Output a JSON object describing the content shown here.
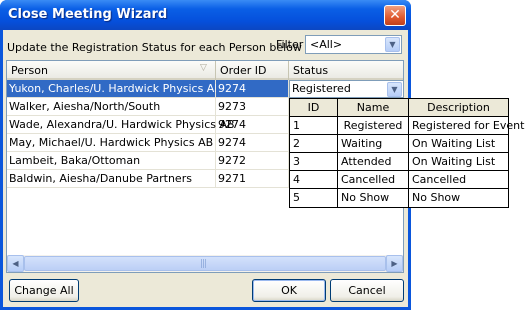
{
  "window": {
    "title": "Close Meeting Wizard",
    "close_glyph": "✕"
  },
  "instruction": "Update the Registration Status for each Person below",
  "filter": {
    "label": "Filter",
    "value": "<All>"
  },
  "grid": {
    "columns": [
      "Person",
      "Order ID",
      "Status"
    ],
    "rows": [
      {
        "person": "Yukon, Charles/U. Hardwick Physics AB",
        "order_id": "9274",
        "status": ""
      },
      {
        "person": "Walker, Aiesha/North/South",
        "order_id": "9273",
        "status": ""
      },
      {
        "person": "Wade, Alexandra/U. Hardwick Physics AB",
        "order_id": "9274",
        "status": ""
      },
      {
        "person": "May, Michael/U. Hardwick Physics AB",
        "order_id": "9274",
        "status": ""
      },
      {
        "person": "Lambeit, Baka/Ottoman",
        "order_id": "9272",
        "status": ""
      },
      {
        "person": "Baldwin, Aiesha/Danube Partners",
        "order_id": "9271",
        "status": ""
      }
    ],
    "selected_row": 0,
    "status_editor_value": "Registered"
  },
  "status_dropdown": {
    "columns": [
      "ID",
      "Name",
      "Description"
    ],
    "options": [
      {
        "id": "1",
        "name": "Registered",
        "description": "Registered for Event"
      },
      {
        "id": "2",
        "name": "Waiting",
        "description": "On Waiting List"
      },
      {
        "id": "3",
        "name": "Attended",
        "description": "On Waiting List"
      },
      {
        "id": "4",
        "name": "Cancelled",
        "description": "Cancelled"
      },
      {
        "id": "5",
        "name": "No Show",
        "description": "No Show"
      }
    ]
  },
  "buttons": {
    "change_all": "Change All",
    "ok": "OK",
    "cancel": "Cancel"
  },
  "colors": {
    "title_bar": "#0a5fe6",
    "selection": "#316ac5",
    "dialog_face": "#ece9d8",
    "close_button": "#e05a30"
  }
}
